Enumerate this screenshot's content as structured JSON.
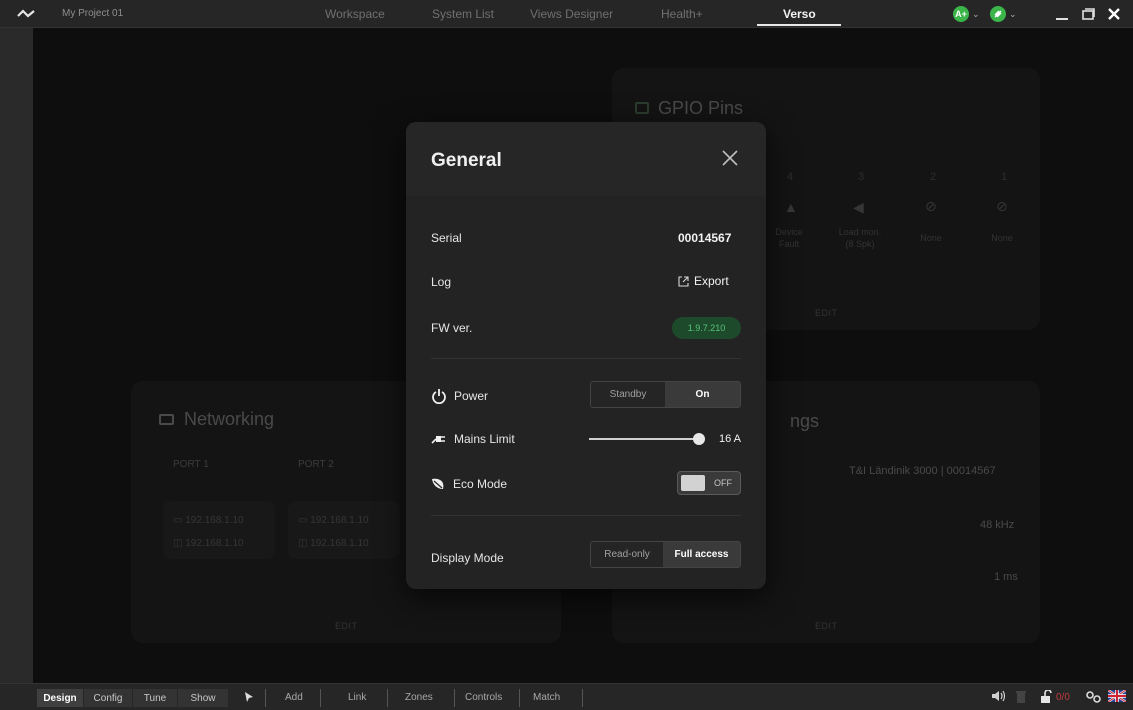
{
  "topbar": {
    "project": "My Project 01",
    "tabs": [
      "Workspace",
      "System List",
      "Views Designer",
      "Health+",
      "Verso"
    ],
    "active_tab": "Verso",
    "pill1": "A+",
    "colors": {
      "accent_green": "#3bb54a"
    }
  },
  "gpio": {
    "title": "GPIO Pins",
    "numbers": [
      "4",
      "3",
      "2",
      "1"
    ],
    "labels": [
      "Device Fault",
      "Load mon. (8 Spk)",
      "None",
      "None"
    ],
    "edit": "EDIT"
  },
  "networking": {
    "title": "Networking",
    "ports": [
      {
        "label": "PORT 1",
        "ip1": "192.168.1.10",
        "ip2": "192.168.1.10"
      },
      {
        "label": "PORT 2",
        "ip1": "192.168.1.10",
        "ip2": "192.168.1.10"
      }
    ],
    "edit": "EDIT"
  },
  "settings": {
    "title_fragment": "ngs",
    "device": "T&I Ländinik 3000 | 00014567",
    "rate": "48 kHz",
    "latency": "1 ms",
    "edit": "EDIT"
  },
  "dialog": {
    "title": "General",
    "serial_label": "Serial",
    "serial_value": "00014567",
    "log_label": "Log",
    "export_label": "Export",
    "fw_label": "FW ver.",
    "fw_value": "1.9.7.210",
    "power_label": "Power",
    "power_options": [
      "Standby",
      "On"
    ],
    "power_selected": "On",
    "mains_label": "Mains Limit",
    "mains_value": "16 A",
    "mains_fraction": 1.0,
    "eco_label": "Eco Mode",
    "eco_state": "OFF",
    "display_label": "Display Mode",
    "display_options": [
      "Read-only",
      "Full access"
    ],
    "display_selected": "Full access"
  },
  "bottombar": {
    "modes": [
      "Design",
      "Config",
      "Tune",
      "Show"
    ],
    "active_mode": "Design",
    "tools": [
      "Add",
      "Link",
      "Zones",
      "Controls",
      "Match"
    ],
    "counter": "0/0"
  }
}
